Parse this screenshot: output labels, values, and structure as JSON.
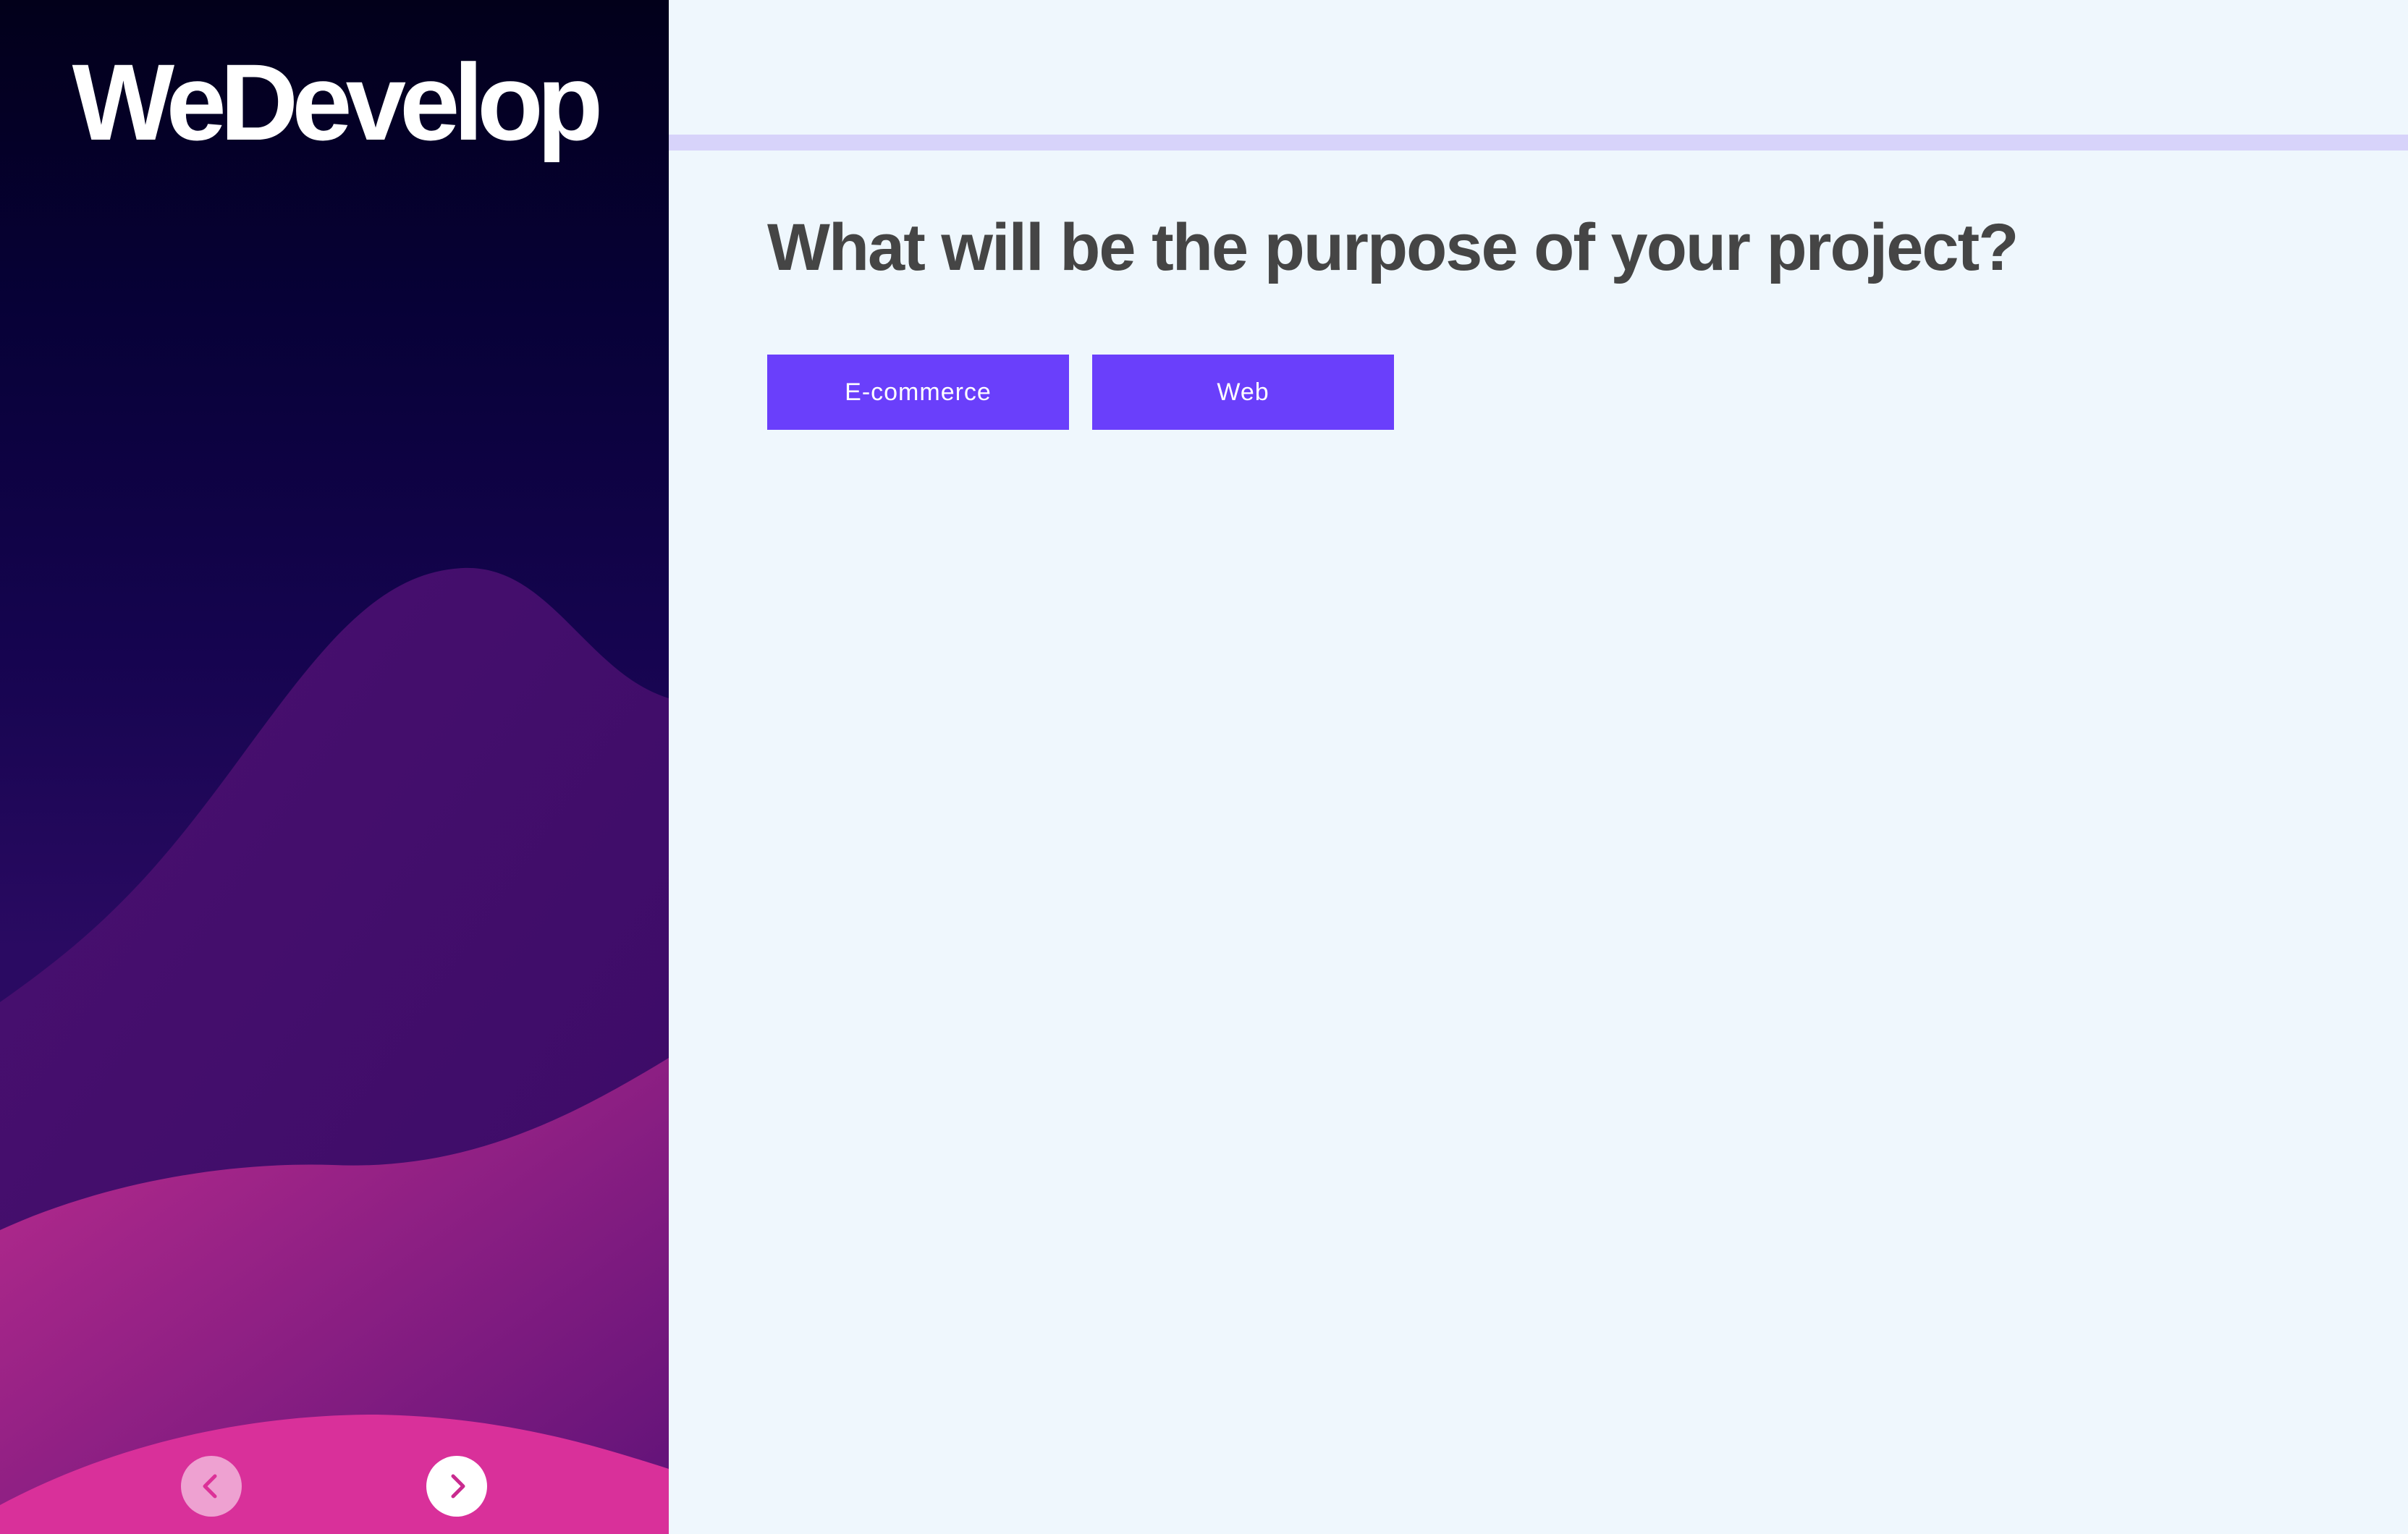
{
  "brand": {
    "logo_text": "WeDevelop"
  },
  "sidebar": {
    "prev_icon": "chevron-left-icon",
    "next_icon": "chevron-right-icon"
  },
  "progress": {
    "value": 0
  },
  "question": {
    "title": "What will be the purpose of your project?"
  },
  "options": [
    {
      "label": "E-commerce"
    },
    {
      "label": "Web"
    }
  ],
  "colors": {
    "accent": "#6a3ffb",
    "progress_track": "#d7d3fa",
    "background": "#eff7fd",
    "question_text": "#454545",
    "sidebar_top": "#02001a",
    "wave_pink": "#dc3198"
  }
}
